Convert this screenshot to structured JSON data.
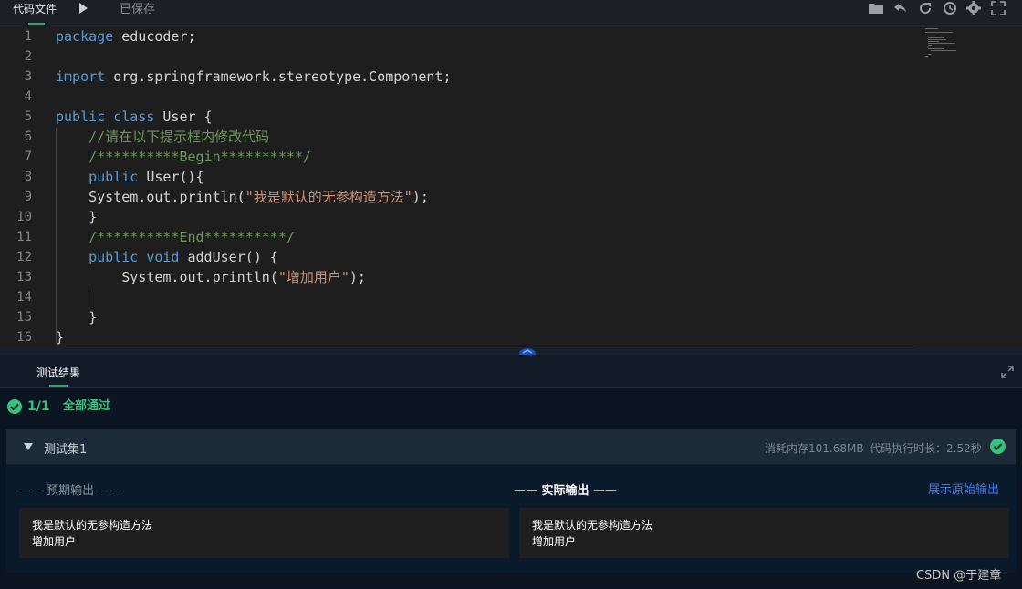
{
  "topbar": {
    "tab_label": "代码文件",
    "saved_status": "已保存"
  },
  "editor": {
    "lines": [
      {
        "n": "1",
        "segments": [
          {
            "t": "package",
            "c": "kw"
          },
          {
            "t": " educoder;",
            "c": "id"
          }
        ]
      },
      {
        "n": "2",
        "segments": []
      },
      {
        "n": "3",
        "segments": [
          {
            "t": "import",
            "c": "kw"
          },
          {
            "t": " org.springframework.stereotype.Component;",
            "c": "id"
          }
        ]
      },
      {
        "n": "4",
        "segments": []
      },
      {
        "n": "5",
        "segments": [
          {
            "t": "public",
            "c": "kw"
          },
          {
            "t": " ",
            "c": "id"
          },
          {
            "t": "class",
            "c": "kw"
          },
          {
            "t": " User {",
            "c": "id"
          }
        ]
      },
      {
        "n": "6",
        "segments": [
          {
            "t": "    //请在以下提示框内修改代码",
            "c": "cm"
          }
        ]
      },
      {
        "n": "7",
        "segments": [
          {
            "t": "    /**********Begin**********/",
            "c": "cm"
          }
        ]
      },
      {
        "n": "8",
        "segments": [
          {
            "t": "    ",
            "c": "id"
          },
          {
            "t": "public",
            "c": "kw"
          },
          {
            "t": " User(){",
            "c": "id"
          }
        ]
      },
      {
        "n": "9",
        "segments": [
          {
            "t": "    System.out.println(",
            "c": "id"
          },
          {
            "t": "\"我是默认的无参构造方法\"",
            "c": "str"
          },
          {
            "t": ");",
            "c": "id"
          }
        ]
      },
      {
        "n": "10",
        "segments": [
          {
            "t": "    }",
            "c": "id"
          }
        ]
      },
      {
        "n": "11",
        "segments": [
          {
            "t": "    /**********End**********/",
            "c": "cm"
          }
        ]
      },
      {
        "n": "12",
        "segments": [
          {
            "t": "    ",
            "c": "id"
          },
          {
            "t": "public",
            "c": "kw"
          },
          {
            "t": " ",
            "c": "id"
          },
          {
            "t": "void",
            "c": "kw"
          },
          {
            "t": " addUser() {",
            "c": "id"
          }
        ]
      },
      {
        "n": "13",
        "segments": [
          {
            "t": "        System.out.println(",
            "c": "id"
          },
          {
            "t": "\"增加用户\"",
            "c": "str"
          },
          {
            "t": ");",
            "c": "id"
          }
        ]
      },
      {
        "n": "14",
        "segments": []
      },
      {
        "n": "15",
        "segments": [
          {
            "t": "    }",
            "c": "id"
          }
        ]
      },
      {
        "n": "16",
        "segments": [
          {
            "t": "}",
            "c": "id"
          }
        ]
      }
    ]
  },
  "results": {
    "title": "测试结果",
    "pass_count": "1/1",
    "pass_label": "全部通过",
    "set": {
      "title": "测试集1",
      "memory": "消耗内存101.68MB",
      "duration": "代码执行时长：2.52秒",
      "expected_label": "—— 预期输出 ——",
      "actual_label": "—— 实际输出 ——",
      "raw_link": "展示原始输出",
      "expected_lines": [
        "我是默认的无参构造方法",
        "增加用户"
      ],
      "actual_lines": [
        "我是默认的无参构造方法",
        "增加用户"
      ]
    }
  },
  "watermark": "CSDN @于建章",
  "colors": {
    "pass": "#33c37a",
    "link": "#3d7ce8",
    "keyword": "#569cd6",
    "comment": "#6a9955",
    "string": "#ce9178"
  }
}
